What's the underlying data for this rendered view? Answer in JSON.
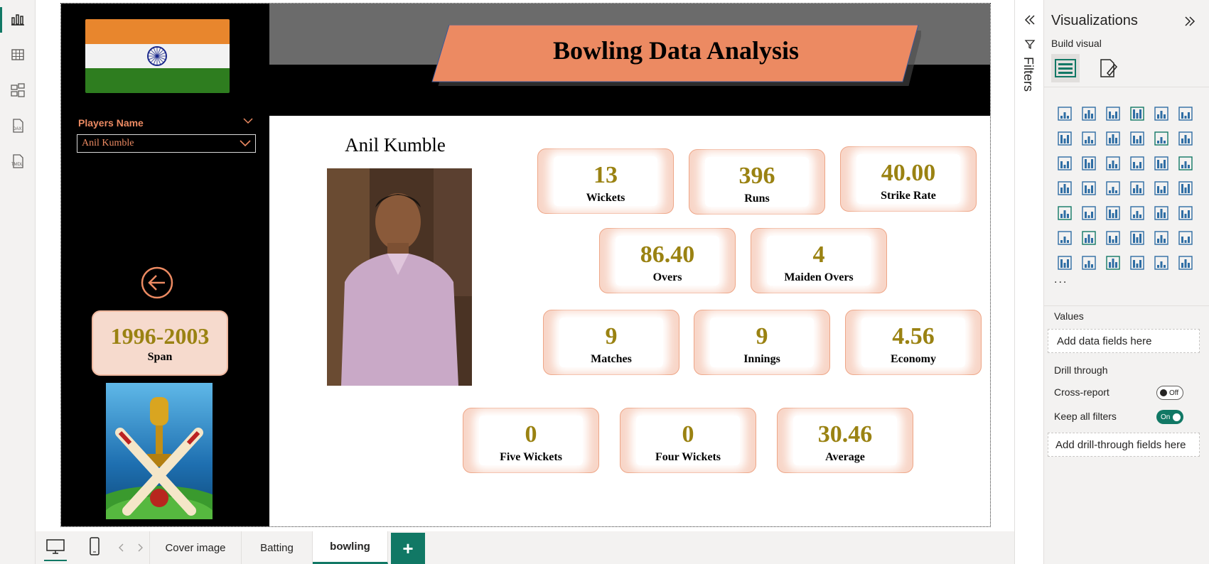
{
  "rail": {
    "icons": [
      "report-view-icon",
      "table-view-icon",
      "model-view-icon",
      "dax-query-icon",
      "tmdl-view-icon"
    ]
  },
  "report": {
    "slicer": {
      "label": "Players Name",
      "value": "Anil Kumble"
    },
    "span": {
      "value": "1996-2003",
      "label": "Span"
    },
    "title": "Bowling Data Analysis",
    "player_name": "Anil Kumble",
    "cards": [
      {
        "value": "13",
        "label": "Wickets"
      },
      {
        "value": "396",
        "label": "Runs"
      },
      {
        "value": "40.00",
        "label": "Strike Rate"
      },
      {
        "value": "86.40",
        "label": "Overs"
      },
      {
        "value": "4",
        "label": "Maiden Overs"
      },
      {
        "value": "9",
        "label": "Matches"
      },
      {
        "value": "9",
        "label": "Innings"
      },
      {
        "value": "4.56",
        "label": "Economy"
      },
      {
        "value": "0",
        "label": "Five Wickets"
      },
      {
        "value": "0",
        "label": "Four Wickets"
      },
      {
        "value": "30.46",
        "label": "Average"
      }
    ],
    "colors": {
      "accent": "#ec8a62",
      "value_gold": "#9a8212",
      "card_bg": "#f8d6c8",
      "header_grey": "#6b6b6b"
    }
  },
  "filters": {
    "label": "Filters"
  },
  "viz_pane": {
    "title": "Visualizations",
    "build_visual": "Build visual",
    "more": "...",
    "values_label": "Values",
    "values_placeholder": "Add data fields here",
    "drill_through_label": "Drill through",
    "cross_report_label": "Cross-report",
    "cross_report_state": "Off",
    "keep_filters_label": "Keep all filters",
    "keep_filters_state": "On",
    "drill_placeholder": "Add drill-through fields here"
  },
  "pages": {
    "tabs": [
      "Cover image",
      "Batting",
      "bowling"
    ],
    "active": "bowling",
    "add_label": "+"
  }
}
